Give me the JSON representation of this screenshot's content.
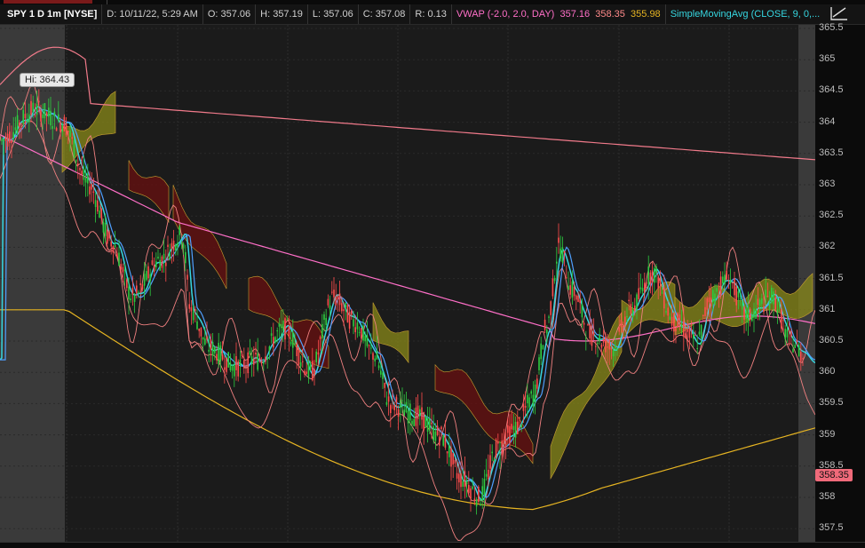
{
  "header": {
    "symbol": "SPY 1 D 1m [NYSE]",
    "date": "D: 10/11/22, 5:29 AM",
    "open": "O: 357.06",
    "high": "H: 357.19",
    "low": "L: 357.06",
    "close": "C: 357.08",
    "range": "R: 0.13",
    "vwap_label": "VWAP (-2.0, 2.0, DAY)",
    "vwap_value": "357.16",
    "vwap_upper": "358.35",
    "vwap_lower": "355.98",
    "sma_label": "SimpleMovingAvg (CLOSE, 9, 0,..."
  },
  "hi_label": "Hi: 364.43",
  "last_price": "358.35",
  "price_axis": [
    "365.5",
    "365",
    "364.5",
    "364",
    "363.5",
    "363",
    "362.5",
    "362",
    "361.5",
    "361",
    "360.5",
    "360",
    "359.5",
    "359",
    "358.5",
    "358",
    "357.5"
  ],
  "icons": {
    "draw_tool": "draw-line-icon"
  },
  "colors": {
    "vwap": "#ff6fc8",
    "band_upper": "#f07a8a",
    "band_lower": "#e6b422",
    "sma": "#36d6e0",
    "up": "#2ecc40",
    "down": "#ff4d4d"
  }
}
